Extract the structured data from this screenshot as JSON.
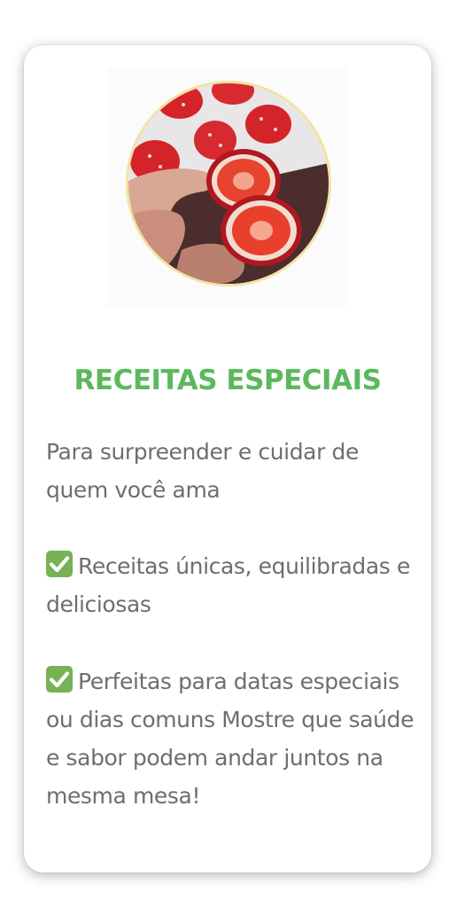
{
  "card": {
    "title": "RECEITAS ESPECIAIS",
    "intro": "Para surpreender e cuidar de quem você ama",
    "bullets": [
      {
        "icon": "check-mark-button-icon",
        "text": "Receitas únicas, equilibradas e deliciosas"
      },
      {
        "icon": "check-mark-button-icon",
        "text": "Perfeitas para datas especiais ou dias comuns"
      }
    ],
    "closing": "Mostre que saúde e sabor podem andar juntos na mesma mesa!"
  },
  "colors": {
    "title": "#5cb85c",
    "text": "#6e6e6e",
    "check": "#77b255",
    "photo_border": "#f3e2a6"
  }
}
